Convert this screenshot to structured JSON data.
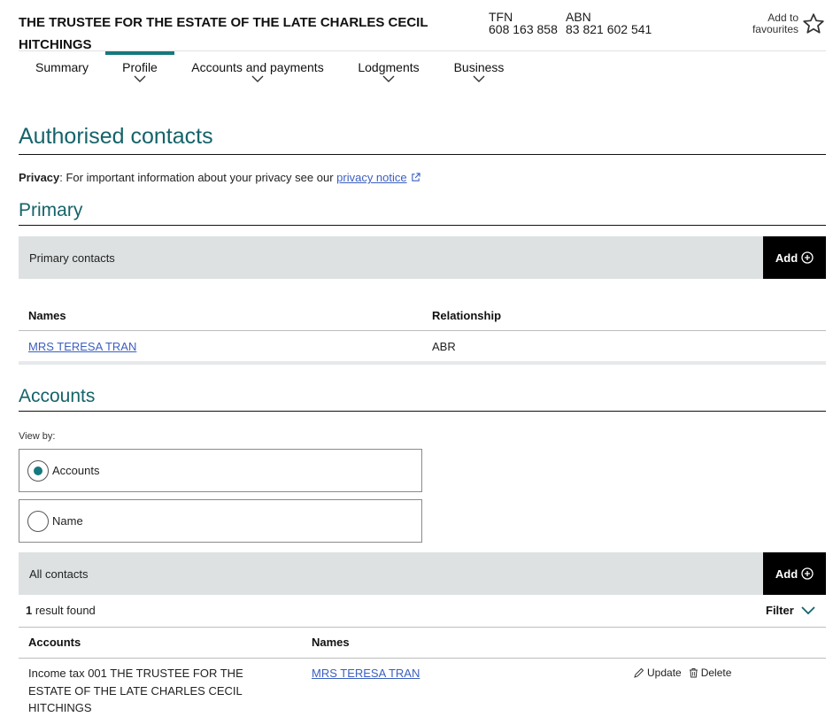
{
  "header": {
    "entity_name": "THE TRUSTEE FOR THE ESTATE OF THE LATE CHARLES CECIL HITCHINGS",
    "tfn_label": "TFN",
    "tfn_value": "608 163 858",
    "abn_label": "ABN",
    "abn_value": "83 821 602 541",
    "favourites_line1": "Add to",
    "favourites_line2": "favourites",
    "favourites_icon": "star-icon"
  },
  "nav": {
    "items": [
      {
        "label": "Summary",
        "has_menu": false,
        "active": false
      },
      {
        "label": "Profile",
        "has_menu": true,
        "active": true
      },
      {
        "label": "Accounts and payments",
        "has_menu": true,
        "active": false
      },
      {
        "label": "Lodgments",
        "has_menu": true,
        "active": false
      },
      {
        "label": "Business",
        "has_menu": true,
        "active": false
      }
    ]
  },
  "page": {
    "title": "Authorised contacts",
    "privacy_label": "Privacy",
    "privacy_text": ": For important information about your privacy see our ",
    "privacy_link": "privacy notice"
  },
  "primary": {
    "heading": "Primary",
    "bar_label": "Primary contacts",
    "add_label": "Add",
    "columns": [
      "Names",
      "Relationship"
    ],
    "rows": [
      {
        "name": "MRS TERESA TRAN",
        "relationship": "ABR"
      }
    ]
  },
  "accounts": {
    "heading": "Accounts",
    "view_by_label": "View by:",
    "view_options": [
      {
        "label": "Accounts",
        "selected": true
      },
      {
        "label": "Name",
        "selected": false
      }
    ],
    "bar_label": "All contacts",
    "add_label": "Add",
    "result_count": "1",
    "result_text": " result found",
    "filter_label": "Filter",
    "columns": [
      "Accounts",
      "Names"
    ],
    "rows": [
      {
        "account": "Income tax 001 THE TRUSTEE FOR THE ESTATE OF THE LATE CHARLES CECIL HITCHINGS",
        "name": "MRS TERESA TRAN",
        "update_label": "Update",
        "delete_label": "Delete"
      }
    ]
  },
  "colors": {
    "accent": "#15797e",
    "heading": "#15636a",
    "link": "#3b5fc0",
    "bar_bg": "#dde1e2",
    "button_bg": "#000000"
  }
}
